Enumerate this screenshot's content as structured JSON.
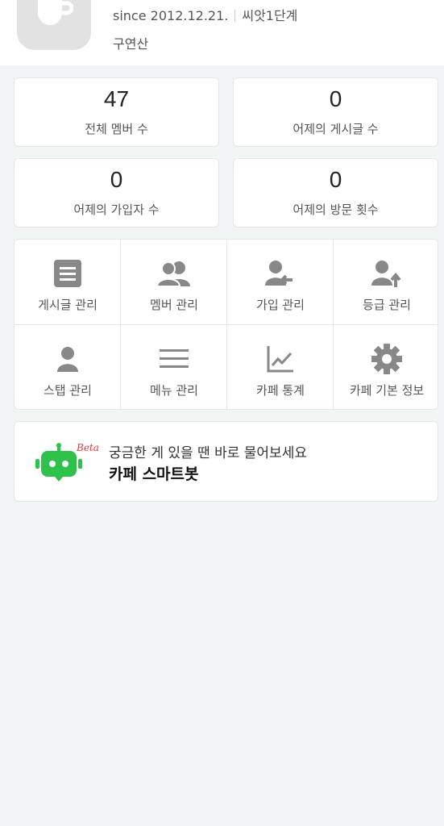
{
  "header": {
    "logo_icon": "coffee-cup-icon",
    "since": "since 2012.12.21.",
    "level": "씨앗1단계",
    "owner": "구연산"
  },
  "stats": [
    {
      "value": "47",
      "label": "전체 멤버 수"
    },
    {
      "value": "0",
      "label": "어제의 게시글 수"
    },
    {
      "value": "0",
      "label": "어제의 가입자 수"
    },
    {
      "value": "0",
      "label": "어제의 방문 횟수"
    }
  ],
  "menu": [
    {
      "label": "게시글 관리",
      "icon": "document-icon"
    },
    {
      "label": "멤버 관리",
      "icon": "members-icon"
    },
    {
      "label": "가입 관리",
      "icon": "user-join-icon"
    },
    {
      "label": "등급 관리",
      "icon": "user-upgrade-icon"
    },
    {
      "label": "스탭 관리",
      "icon": "person-icon"
    },
    {
      "label": "메뉴 관리",
      "icon": "hamburger-menu-icon"
    },
    {
      "label": "카페 통계",
      "icon": "line-chart-icon"
    },
    {
      "label": "카페 기본 정보",
      "icon": "gear-icon"
    }
  ],
  "smartbot": {
    "badge": "Beta",
    "question": "궁금한 게 있을 땐 바로 물어보세요",
    "name": "카페 스마트봇",
    "icon": "robot-icon",
    "accent": "#2ec24d"
  }
}
